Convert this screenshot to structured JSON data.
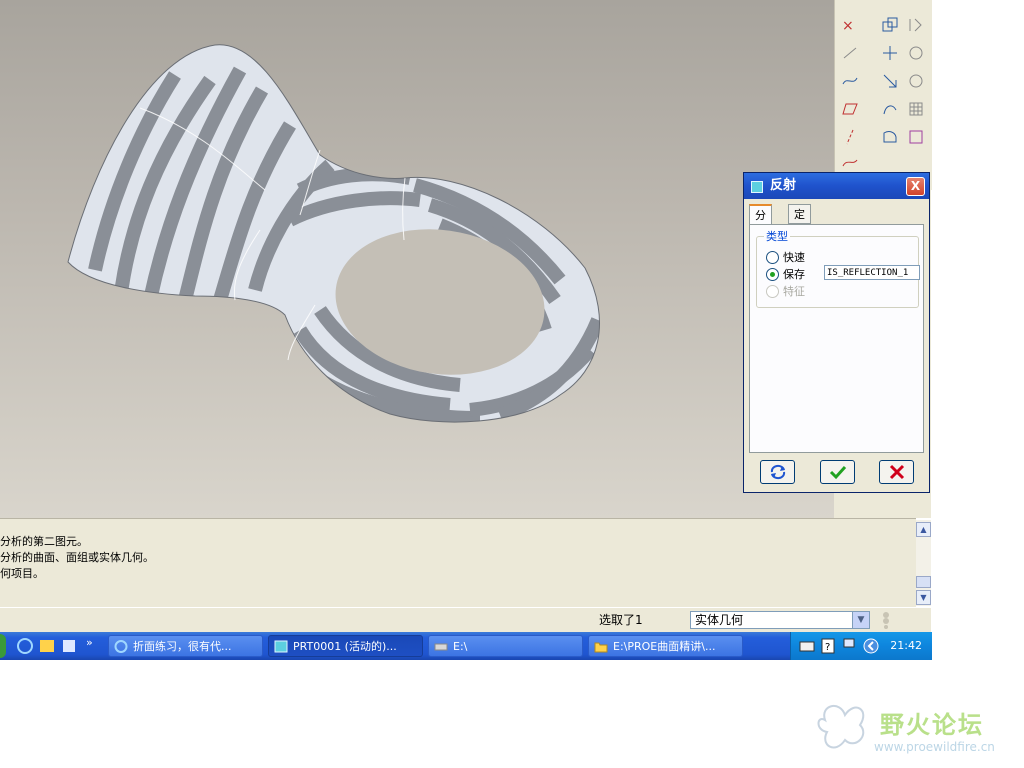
{
  "dialog": {
    "title": "反射",
    "close_label": "X",
    "tabs": [
      {
        "label": "分析"
      },
      {
        "label": "定义"
      }
    ],
    "type_group_label": "类型",
    "options": [
      {
        "label": "快速",
        "selected": false,
        "enabled": true
      },
      {
        "label": "保存",
        "selected": true,
        "enabled": true
      },
      {
        "label": "特征",
        "selected": false,
        "enabled": false
      }
    ],
    "name_value": "IS_REFLECTION_1",
    "buttons": {
      "repeat": "repeat-icon",
      "ok": "check-icon",
      "cancel": "cross-icon"
    }
  },
  "messages": [
    "分析的第二图元。",
    "分析的曲面、面组或实体几何。",
    "何项目。"
  ],
  "status": {
    "selected": "选取了1",
    "filter": "实体几何"
  },
  "taskbar": {
    "items": [
      {
        "label": "折面练习，很有代...",
        "icon": "ie-icon"
      },
      {
        "label": "PRT0001 (活动的)...",
        "icon": "proe-icon"
      },
      {
        "label": "E:\\",
        "icon": "drive-icon"
      },
      {
        "label": "E:\\PROE曲面精讲\\...",
        "icon": "folder-icon"
      }
    ],
    "more": "»",
    "clock": "21:42"
  },
  "watermark": {
    "name": "野火论坛",
    "url": "www.proewildfire.cn"
  },
  "colors": {
    "accent": "#0a246a",
    "titlebar": "#245edb",
    "taskbar": "#245edb",
    "ok": "#21a121",
    "cancel": "#d0001a"
  }
}
